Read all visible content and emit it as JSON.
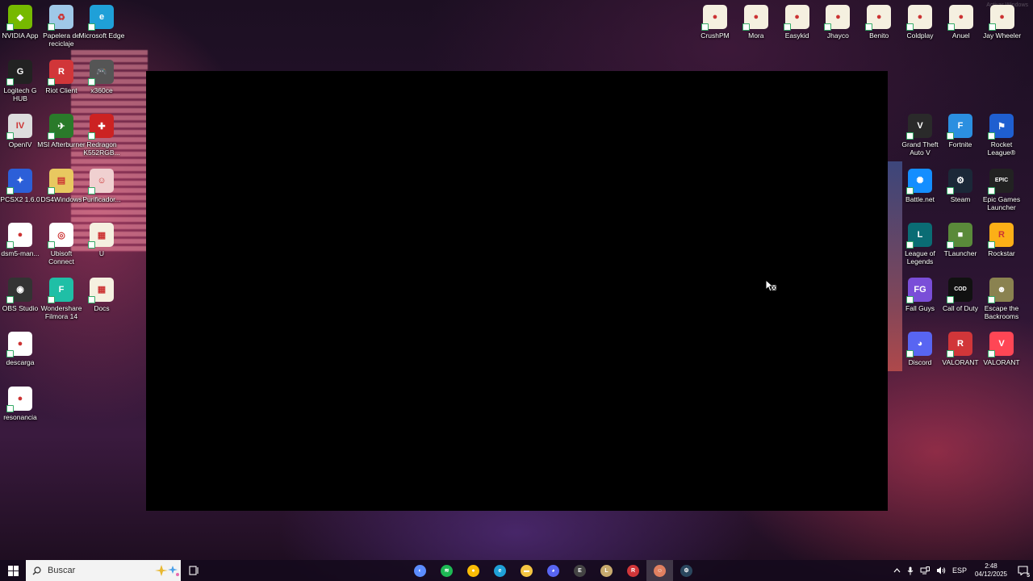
{
  "desktop": {
    "watermark": "Activar Windows",
    "icons_left": [
      {
        "label": "NVIDIA App",
        "icon": "nvidia-icon",
        "color": "#76b900",
        "glyph": "◆"
      },
      {
        "label": "Papelera de reciclaje",
        "icon": "recycle-bin-icon",
        "color": "#9fc8e8",
        "glyph": "♻"
      },
      {
        "label": "Microsoft Edge",
        "icon": "edge-icon",
        "color": "#1fa0d8",
        "glyph": "e"
      },
      {
        "label": "Logitech G HUB",
        "icon": "logitech-icon",
        "color": "#222",
        "glyph": "G"
      },
      {
        "label": "Riot Client",
        "icon": "riot-icon",
        "color": "#d13639",
        "glyph": "R"
      },
      {
        "label": "x360ce",
        "icon": "gamepad-icon",
        "color": "#555",
        "glyph": "🎮"
      },
      {
        "label": "OpenIV",
        "icon": "openiv-icon",
        "color": "#ddd",
        "glyph": "IV"
      },
      {
        "label": "MSI Afterburner",
        "icon": "msi-afterburner-icon",
        "color": "#2a7a2a",
        "glyph": "✈"
      },
      {
        "label": "Redragon K552RGB...",
        "icon": "redragon-icon",
        "color": "#c22",
        "glyph": "✚"
      },
      {
        "label": "PCSX2 1.6.0",
        "icon": "pcsx2-icon",
        "color": "#2c5fd8",
        "glyph": "✦"
      },
      {
        "label": "DS4Windows",
        "icon": "folder-icon",
        "color": "#e8c860",
        "glyph": "▤"
      },
      {
        "label": "Purificador...",
        "icon": "purificador-icon",
        "color": "#f0d0d0",
        "glyph": "☺"
      },
      {
        "label": "dsm5-man...",
        "icon": "chrome-icon",
        "color": "#fff",
        "glyph": "●"
      },
      {
        "label": "Ubisoft Connect",
        "icon": "ubisoft-icon",
        "color": "#fff",
        "glyph": "◎"
      },
      {
        "label": "U",
        "icon": "document-icon",
        "color": "#f5f0e0",
        "glyph": "▦"
      },
      {
        "label": "OBS Studio",
        "icon": "obs-icon",
        "color": "#333",
        "glyph": "◉"
      },
      {
        "label": "Wondershare Filmora 14",
        "icon": "filmora-icon",
        "color": "#1fbfa6",
        "glyph": "F"
      },
      {
        "label": "Docs",
        "icon": "document-icon",
        "color": "#f5f0e0",
        "glyph": "▦"
      },
      {
        "label": "descarga",
        "icon": "chrome-icon",
        "color": "#fff",
        "glyph": "●"
      },
      {
        "label": "resonancia",
        "icon": "chrome-icon",
        "color": "#fff",
        "glyph": "●"
      }
    ],
    "icons_top_right": [
      {
        "label": "CrushPM",
        "icon": "chrome-doc-icon",
        "color": "#f5f0e0",
        "glyph": "●"
      },
      {
        "label": "Mora",
        "icon": "chrome-doc-icon",
        "color": "#f5f0e0",
        "glyph": "●"
      },
      {
        "label": "Easykid",
        "icon": "chrome-doc-icon",
        "color": "#f5f0e0",
        "glyph": "●"
      },
      {
        "label": "Jhayco",
        "icon": "chrome-doc-icon",
        "color": "#f5f0e0",
        "glyph": "●"
      },
      {
        "label": "Benito",
        "icon": "chrome-doc-icon",
        "color": "#f5f0e0",
        "glyph": "●"
      },
      {
        "label": "Coldplay",
        "icon": "chrome-doc-icon",
        "color": "#f5f0e0",
        "glyph": "●"
      },
      {
        "label": "Anuel",
        "icon": "chrome-doc-icon",
        "color": "#f5f0e0",
        "glyph": "●"
      },
      {
        "label": "Jay Wheeler",
        "icon": "chrome-doc-icon",
        "color": "#f5f0e0",
        "glyph": "●"
      }
    ],
    "icons_right": [
      {
        "label": "Grand Theft Auto V",
        "icon": "gta-icon",
        "color": "#2a2a2a",
        "glyph": "V"
      },
      {
        "label": "Fortnite",
        "icon": "fortnite-icon",
        "color": "#2b8fe0",
        "glyph": "F"
      },
      {
        "label": "Rocket League®",
        "icon": "rocket-league-icon",
        "color": "#1f5fd0",
        "glyph": "⚑"
      },
      {
        "label": "Battle.net",
        "icon": "battlenet-icon",
        "color": "#148eff",
        "glyph": "✺"
      },
      {
        "label": "Steam",
        "icon": "steam-icon",
        "color": "#1b2838",
        "glyph": "⚙"
      },
      {
        "label": "Epic Games Launcher",
        "icon": "epic-icon",
        "color": "#222",
        "glyph": "EPIC"
      },
      {
        "label": "League of Legends",
        "icon": "lol-icon",
        "color": "#0a6c74",
        "glyph": "L"
      },
      {
        "label": "TLauncher",
        "icon": "minecraft-icon",
        "color": "#5a8a3a",
        "glyph": "■"
      },
      {
        "label": "Rockstar",
        "icon": "rockstar-icon",
        "color": "#fcaf17",
        "glyph": "R"
      },
      {
        "label": "Fall Guys",
        "icon": "fall-guys-icon",
        "color": "#7a4ed8",
        "glyph": "FG"
      },
      {
        "label": "Call of Duty",
        "icon": "cod-icon",
        "color": "#111",
        "glyph": "COD"
      },
      {
        "label": "Escape the Backrooms",
        "icon": "backrooms-icon",
        "color": "#8a8250",
        "glyph": "☻"
      },
      {
        "label": "Discord",
        "icon": "discord-icon",
        "color": "#5865f2",
        "glyph": "◕"
      },
      {
        "label": "VALORANT",
        "icon": "riot-icon",
        "color": "#d13639",
        "glyph": "R"
      },
      {
        "label": "VALORANT",
        "icon": "valorant-icon",
        "color": "#ff4655",
        "glyph": "V"
      }
    ]
  },
  "taskbar": {
    "search_placeholder": "Buscar",
    "pinned": [
      {
        "icon": "copilot-icon",
        "color": "#5b8cff",
        "glyph": "◐"
      },
      {
        "icon": "spotify-icon",
        "color": "#1db954",
        "glyph": "≋"
      },
      {
        "icon": "chrome-icon",
        "color": "#fbbc05",
        "glyph": "●"
      },
      {
        "icon": "edge-icon",
        "color": "#1fa0d8",
        "glyph": "e"
      },
      {
        "icon": "file-explorer-icon",
        "color": "#f4c542",
        "glyph": "▬"
      },
      {
        "icon": "discord-icon",
        "color": "#5865f2",
        "glyph": "◕"
      },
      {
        "icon": "epic-icon",
        "color": "#444",
        "glyph": "E"
      },
      {
        "icon": "lol-icon",
        "color": "#c8aa6e",
        "glyph": "L"
      },
      {
        "icon": "riot-icon",
        "color": "#d13639",
        "glyph": "R"
      },
      {
        "icon": "game-app-icon",
        "color": "#e08060",
        "glyph": "☺"
      },
      {
        "icon": "steam-icon",
        "color": "#2a475e",
        "glyph": "⚙"
      }
    ],
    "active_index": 9,
    "tray": {
      "language": "ESP",
      "time": "2:48",
      "date": "04/12/2025",
      "notification_count": "5"
    }
  }
}
